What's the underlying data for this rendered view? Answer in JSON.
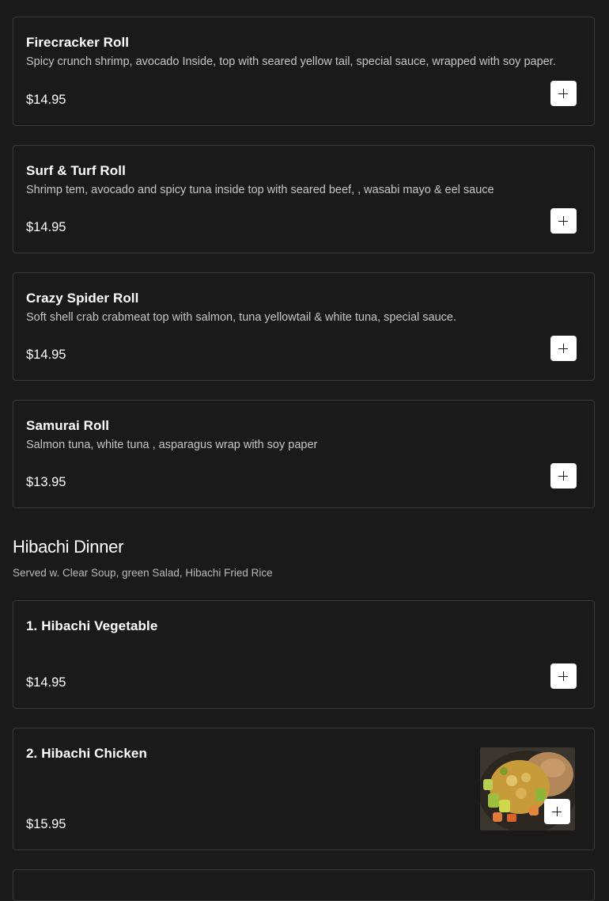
{
  "items": [
    {
      "name": "Firecracker Roll",
      "description": "Spicy crunch shrimp, avocado Inside, top with seared yellow tail, special sauce, wrapped with soy paper.",
      "price": "$14.95"
    },
    {
      "name": "Surf & Turf Roll",
      "description": "Shrimp tem, avocado and spicy tuna inside top with seared beef, , wasabi mayo & eel sauce",
      "price": "$14.95"
    },
    {
      "name": "Crazy Spider Roll",
      "description": "Soft shell crab crabmeat top with salmon, tuna yellowtail & white tuna, special sauce.",
      "price": "$14.95"
    },
    {
      "name": "Samurai Roll",
      "description": "Salmon tuna, white tuna , asparagus wrap with soy paper",
      "price": "$13.95"
    }
  ],
  "section": {
    "title": "Hibachi Dinner",
    "subtitle": "Served w. Clear Soup, green Salad, Hibachi Fried Rice"
  },
  "hibachi_items": [
    {
      "name": "1. Hibachi Vegetable",
      "price": "$14.95"
    },
    {
      "name": "2. Hibachi Chicken",
      "price": "$15.95",
      "image": "hibachi-chicken-photo"
    }
  ],
  "icons": {
    "add": "plus-icon"
  },
  "colors": {
    "background": "#1b1a1a",
    "card_border": "#3a3939",
    "button": "#ffffff"
  }
}
